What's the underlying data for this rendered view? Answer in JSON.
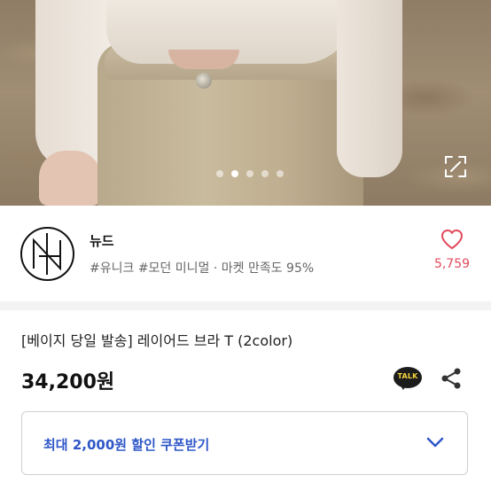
{
  "hero": {
    "slide_count": 5,
    "active_slide": 2
  },
  "brand": {
    "name": "뉴드",
    "tags": "#유니크 #모던 미니멀 · 마켓 만족도 95%",
    "logo_icon": "nude-logo-icon"
  },
  "like": {
    "icon": "heart-outline-icon",
    "count": "5,759",
    "color": "#e04a5c"
  },
  "product": {
    "title": "[베이지 당일 발송] 레이어드 브라 T (2color)",
    "price": "34,200원"
  },
  "actions": {
    "talk_label": "TALK",
    "share_icon": "share-icon"
  },
  "coupon": {
    "label": "최대 2,000원 할인 쿠폰받기",
    "accent_color": "#2e56c8"
  }
}
